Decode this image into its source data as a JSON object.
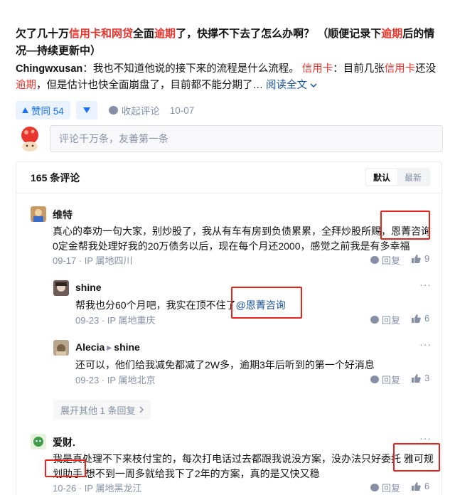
{
  "answer": {
    "title_parts": [
      {
        "text": "欠了几十万",
        "hl": false
      },
      {
        "text": "信用卡和网贷",
        "hl": true
      },
      {
        "text": "全面",
        "hl": false
      },
      {
        "text": "逾期",
        "hl": true
      },
      {
        "text": "了，快撑不下去了怎么办啊？ （顺便记录下",
        "hl": false
      },
      {
        "text": "逾期",
        "hl": true
      },
      {
        "text": "后的情况—持续更新中）",
        "hl": false
      }
    ],
    "author": "Chingwxusan",
    "excerpt_parts": [
      {
        "text": "：我也不知道他说的接下来的流程是什么流程。 ",
        "hl": false
      },
      {
        "text": "信用卡",
        "hl": true
      },
      {
        "text": "：目前几张",
        "hl": false
      },
      {
        "text": "信用卡",
        "hl": true
      },
      {
        "text": "还没",
        "hl": false
      },
      {
        "text": "逾期",
        "hl": true
      },
      {
        "text": "，但是估计也快全面崩盘了，目前都不能分期了… ",
        "hl": false
      }
    ],
    "read_more": "阅读全文",
    "vote_up_label": "赞同 54",
    "collapse_comments_label": "收起评论",
    "date": "10-07"
  },
  "composer": {
    "placeholder": "评论千万条，友善第一条"
  },
  "comments_header": {
    "count_label": "165 条评论",
    "sort_default": "默认",
    "sort_latest": "最新"
  },
  "comments": {
    "c1": {
      "name": "维特",
      "line1": "真心的奉劝一句大家，别炒股了，我从有车有房到负债累累，全拜炒股所赐，恩菁咨询",
      "line2": "0定金帮我处理好我的20万债务以后，现在每个月还2000，感觉之前我是有多幸福",
      "meta": "09-17 · IP 属地四川",
      "likes": "9"
    },
    "c2": {
      "name": "shine",
      "body": "帮我也分60个月吧，我实在顶不住了",
      "mention": "@恩菁咨询",
      "meta": "09-23 · IP 属地重庆",
      "likes": "6"
    },
    "c3": {
      "name": "Alecia",
      "reply_to": "shine",
      "body": "还可以，他们给我减免都减了2W多，逾期3年后听到的第一个好消息",
      "meta": "09-23 · IP 属地北京",
      "likes": "3"
    },
    "c4": {
      "name": "爱财.",
      "line1": "我是真处理不下来枝付宝的，每次打电话过去都跟我说没方案，没办法只好委托 雅可规",
      "line2": "划助手 想不到一周多就给我下了2年的方案，真的是又快又稳",
      "meta": "10-26 · IP 属地黑龙江",
      "likes": "6"
    },
    "reply_label": "回复",
    "expand_label": "展开其他 1 条回复"
  }
}
